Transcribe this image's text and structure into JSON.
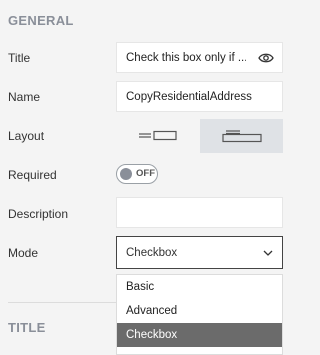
{
  "general": {
    "header": "GENERAL",
    "title_label": "Title",
    "title_value": "Check this box only if ...",
    "name_label": "Name",
    "name_value": "CopyResidentialAddress",
    "layout_label": "Layout",
    "layout_options": [
      "inline-layout",
      "stacked-layout"
    ],
    "layout_selected": 1,
    "required_label": "Required",
    "required_state": "OFF",
    "description_label": "Description",
    "description_value": "",
    "mode_label": "Mode",
    "mode_value": "Checkbox",
    "mode_options": [
      "Basic",
      "Advanced",
      "Checkbox"
    ],
    "mode_selected": 2
  },
  "title_section": {
    "header": "TITLE"
  },
  "icons": {
    "visibility": "eye-icon",
    "dropdown": "chevron-down-icon"
  },
  "colors": {
    "header": "#8a8f99",
    "selected_option": "#6b6b6b",
    "layout_selected_bg": "#dfe2e6"
  }
}
